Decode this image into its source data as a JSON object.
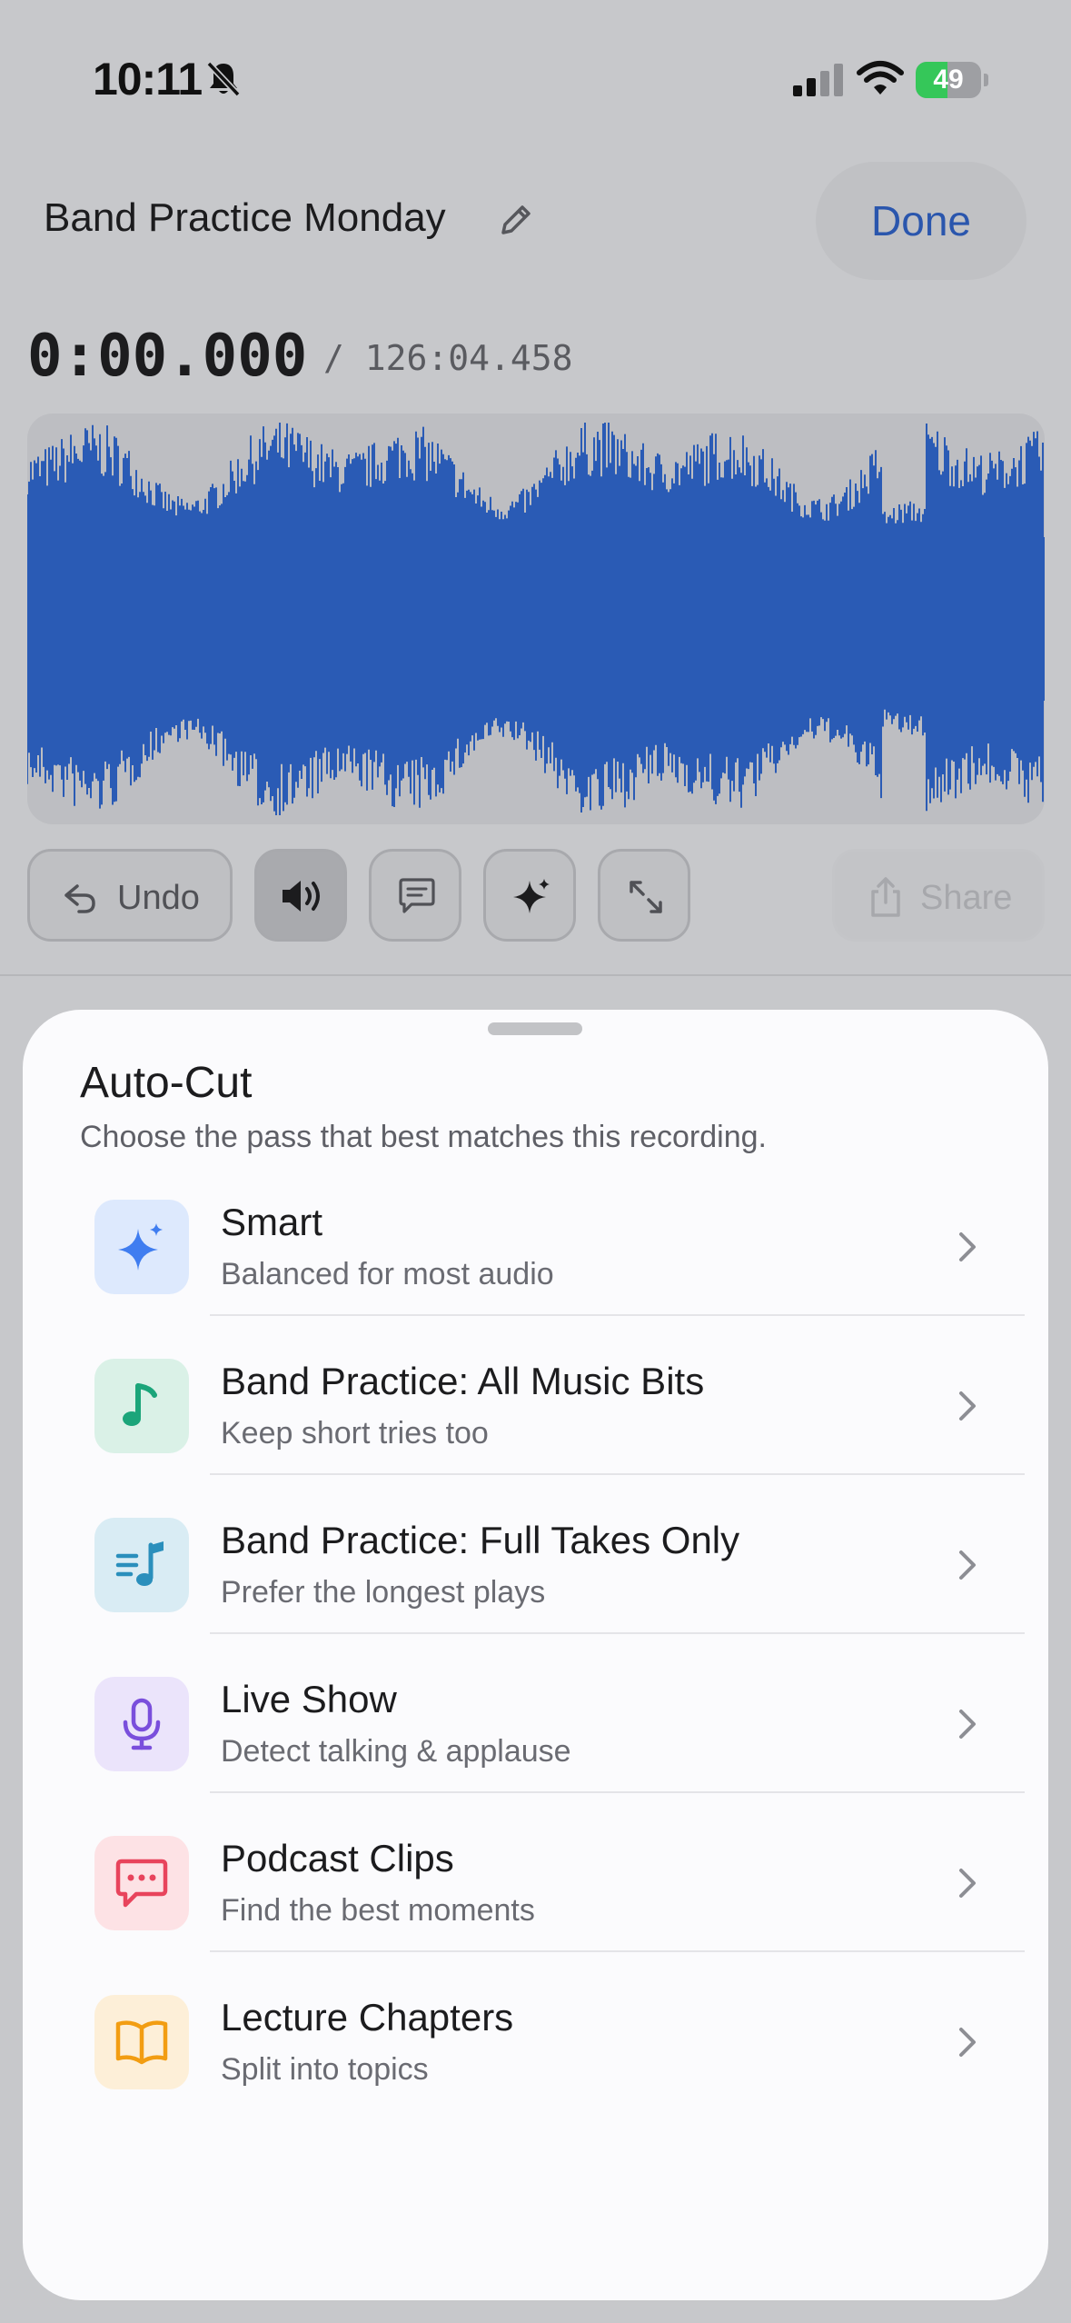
{
  "status_bar": {
    "time": "10:11",
    "battery_percent": "49",
    "battery_level": 0.49,
    "battery_color": "#35c759"
  },
  "header": {
    "title": "Band Practice Monday",
    "done_label": "Done"
  },
  "playback": {
    "current_time": "0:00.000",
    "total_time": "/ 126:04.458"
  },
  "waveform": {
    "color": "#2a5bb5"
  },
  "toolbar": {
    "undo_label": "Undo",
    "share_label": "Share"
  },
  "sheet": {
    "title": "Auto-Cut",
    "subtitle": "Choose the pass that best matches this recording.",
    "options": [
      {
        "title": "Smart",
        "subtitle": "Balanced for most audio",
        "icon": "sparkles-icon",
        "tile_color": "#dde9fd",
        "icon_color": "#3f7df0"
      },
      {
        "title": "Band Practice: All Music Bits",
        "subtitle": "Keep short tries too",
        "icon": "music-note-icon",
        "tile_color": "#daf1e7",
        "icon_color": "#1ba57a"
      },
      {
        "title": "Band Practice: Full Takes Only",
        "subtitle": "Prefer the longest plays",
        "icon": "music-list-icon",
        "tile_color": "#d9ecf4",
        "icon_color": "#2a8fbc"
      },
      {
        "title": "Live Show",
        "subtitle": "Detect talking & applause",
        "icon": "microphone-icon",
        "tile_color": "#ebe4fb",
        "icon_color": "#7a4fdc"
      },
      {
        "title": "Podcast Clips",
        "subtitle": "Find the best moments",
        "icon": "chat-bubble-icon",
        "tile_color": "#fde2e5",
        "icon_color": "#e8445c"
      },
      {
        "title": "Lecture Chapters",
        "subtitle": "Split into topics",
        "icon": "book-icon",
        "tile_color": "#fdefd8",
        "icon_color": "#f29d12"
      }
    ]
  }
}
